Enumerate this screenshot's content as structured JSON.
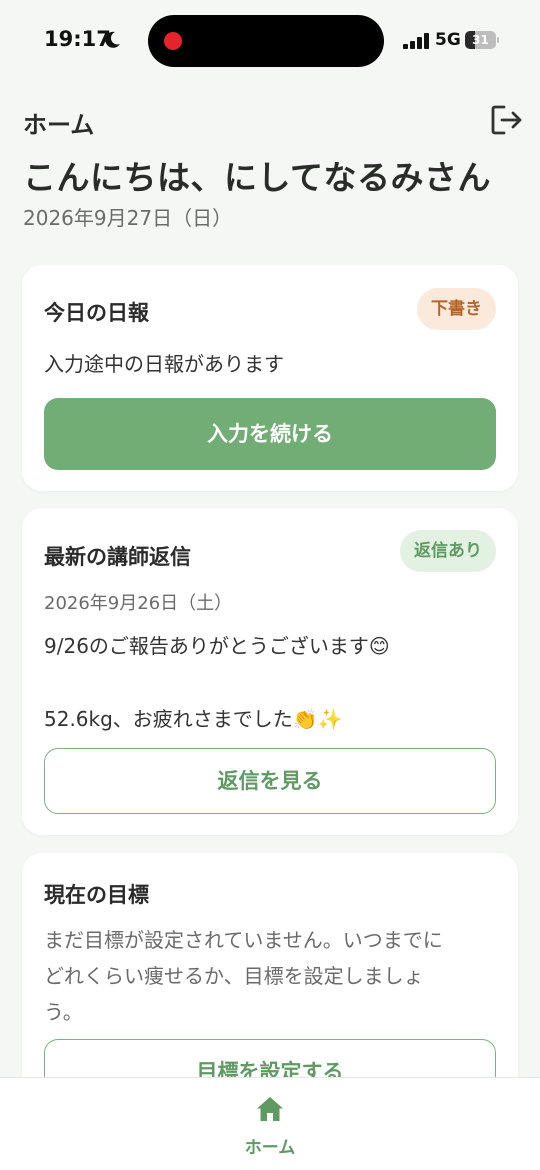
{
  "status_bar": {
    "time": "19:17",
    "network": "5G",
    "battery_level": "31"
  },
  "header": {
    "page_label": "ホーム",
    "greeting": "こんにちは、にしてなるみさん",
    "date": "2026年9月27日（日）"
  },
  "today_report": {
    "title": "今日の日報",
    "badge": "下書き",
    "message": "入力途中の日報があります",
    "button": "入力を続ける"
  },
  "latest_reply": {
    "title": "最新の講師返信",
    "badge": "返信あり",
    "date": "2026年9月26日（土）",
    "line1": "9/26のご報告ありがとうございます😊",
    "line2": "52.6kg、お疲れさまでした👏✨",
    "button": "返信を見る"
  },
  "current_goal": {
    "title": "現在の目標",
    "message_line1": "まだ目標が設定されていません。いつまでに",
    "message_line2": "どれくらい痩せるか、目標を設定しましょ",
    "message_line3": "う。",
    "button": "目標を設定する"
  },
  "bottom_nav": {
    "home_label": "ホーム"
  },
  "colors": {
    "accent_green": "#72ad76",
    "draft_badge_bg": "#fbe9dc",
    "draft_badge_text": "#b5662c",
    "reply_badge_bg": "#e3f1e3",
    "reply_badge_text": "#5f9a63"
  }
}
